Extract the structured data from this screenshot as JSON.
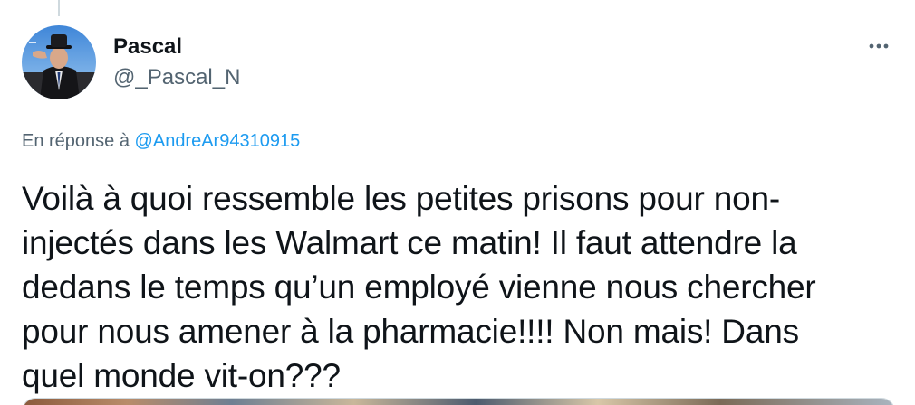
{
  "author": {
    "display_name": "Pascal",
    "handle": "@_Pascal_N"
  },
  "reply_context": {
    "prefix": "En réponse à",
    "mention": "@AndreAr94310915"
  },
  "tweet": {
    "text": "Voilà à quoi ressemble les petites prisons pour non-\ninjectés dans les Walmart ce matin! Il faut attendre la\ndedans le temps qu’un employé vienne nous chercher\npour nous amener à la pharmacie!!!! Non mais! Dans\nquel monde vit-on???"
  },
  "icons": {
    "more": "more-horizontal-icon"
  },
  "colors": {
    "text_primary": "#0f1419",
    "text_secondary": "#536471",
    "link": "#1d9bf0"
  }
}
